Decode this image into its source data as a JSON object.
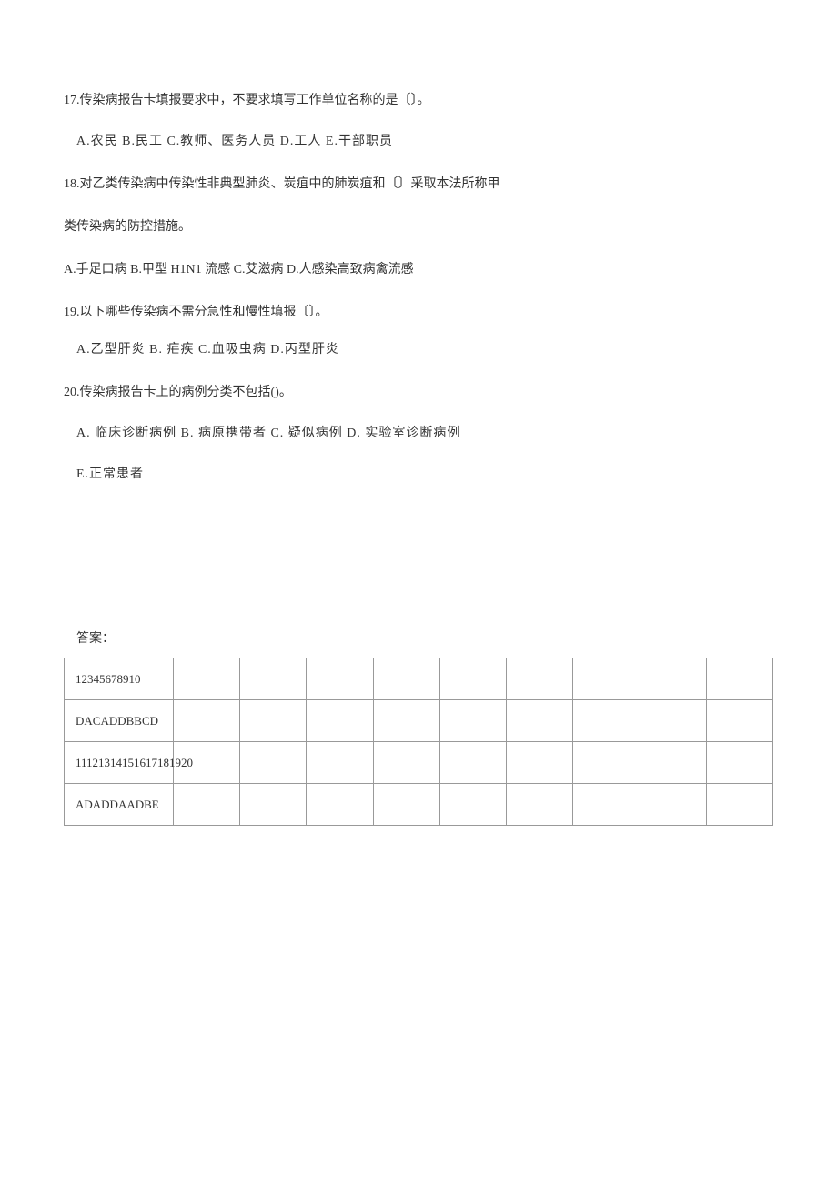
{
  "questions": [
    {
      "number": "17.",
      "text": "传染病报告卡填报要求中，不要求填写工作单位名称的是〔〕。",
      "options": "A.农民 B.民工 C.教师、医务人员 D.工人 E.干部职员"
    },
    {
      "number": "18.",
      "text": "对乙类传染病中传染性非典型肺炎、炭疽中的肺炭疽和〔〕采取本法所称甲",
      "continuation": "类传染病的防控措施。",
      "options": "A.手足口病 B.甲型 H1N1 流感 C.艾滋病 D.人感染高致病禽流感"
    },
    {
      "number": "19.",
      "text": "以下哪些传染病不需分急性和慢性填报〔〕。",
      "options": "A.乙型肝炎 B. 疟疾 C.血吸虫病 D.丙型肝炎"
    },
    {
      "number": "20.",
      "text": "传染病报告卡上的病例分类不包括()。",
      "options": "A. 临床诊断病例 B. 病原携带者 C. 疑似病例 D. 实验室诊断病例",
      "options2": "E.正常患者"
    }
  ],
  "answer_label": "答案：",
  "answer_table": {
    "row1": "12345678910",
    "row2": "DACADDBBCD",
    "row3": "11121314151617181920",
    "row4": "ADADDAADBE"
  }
}
